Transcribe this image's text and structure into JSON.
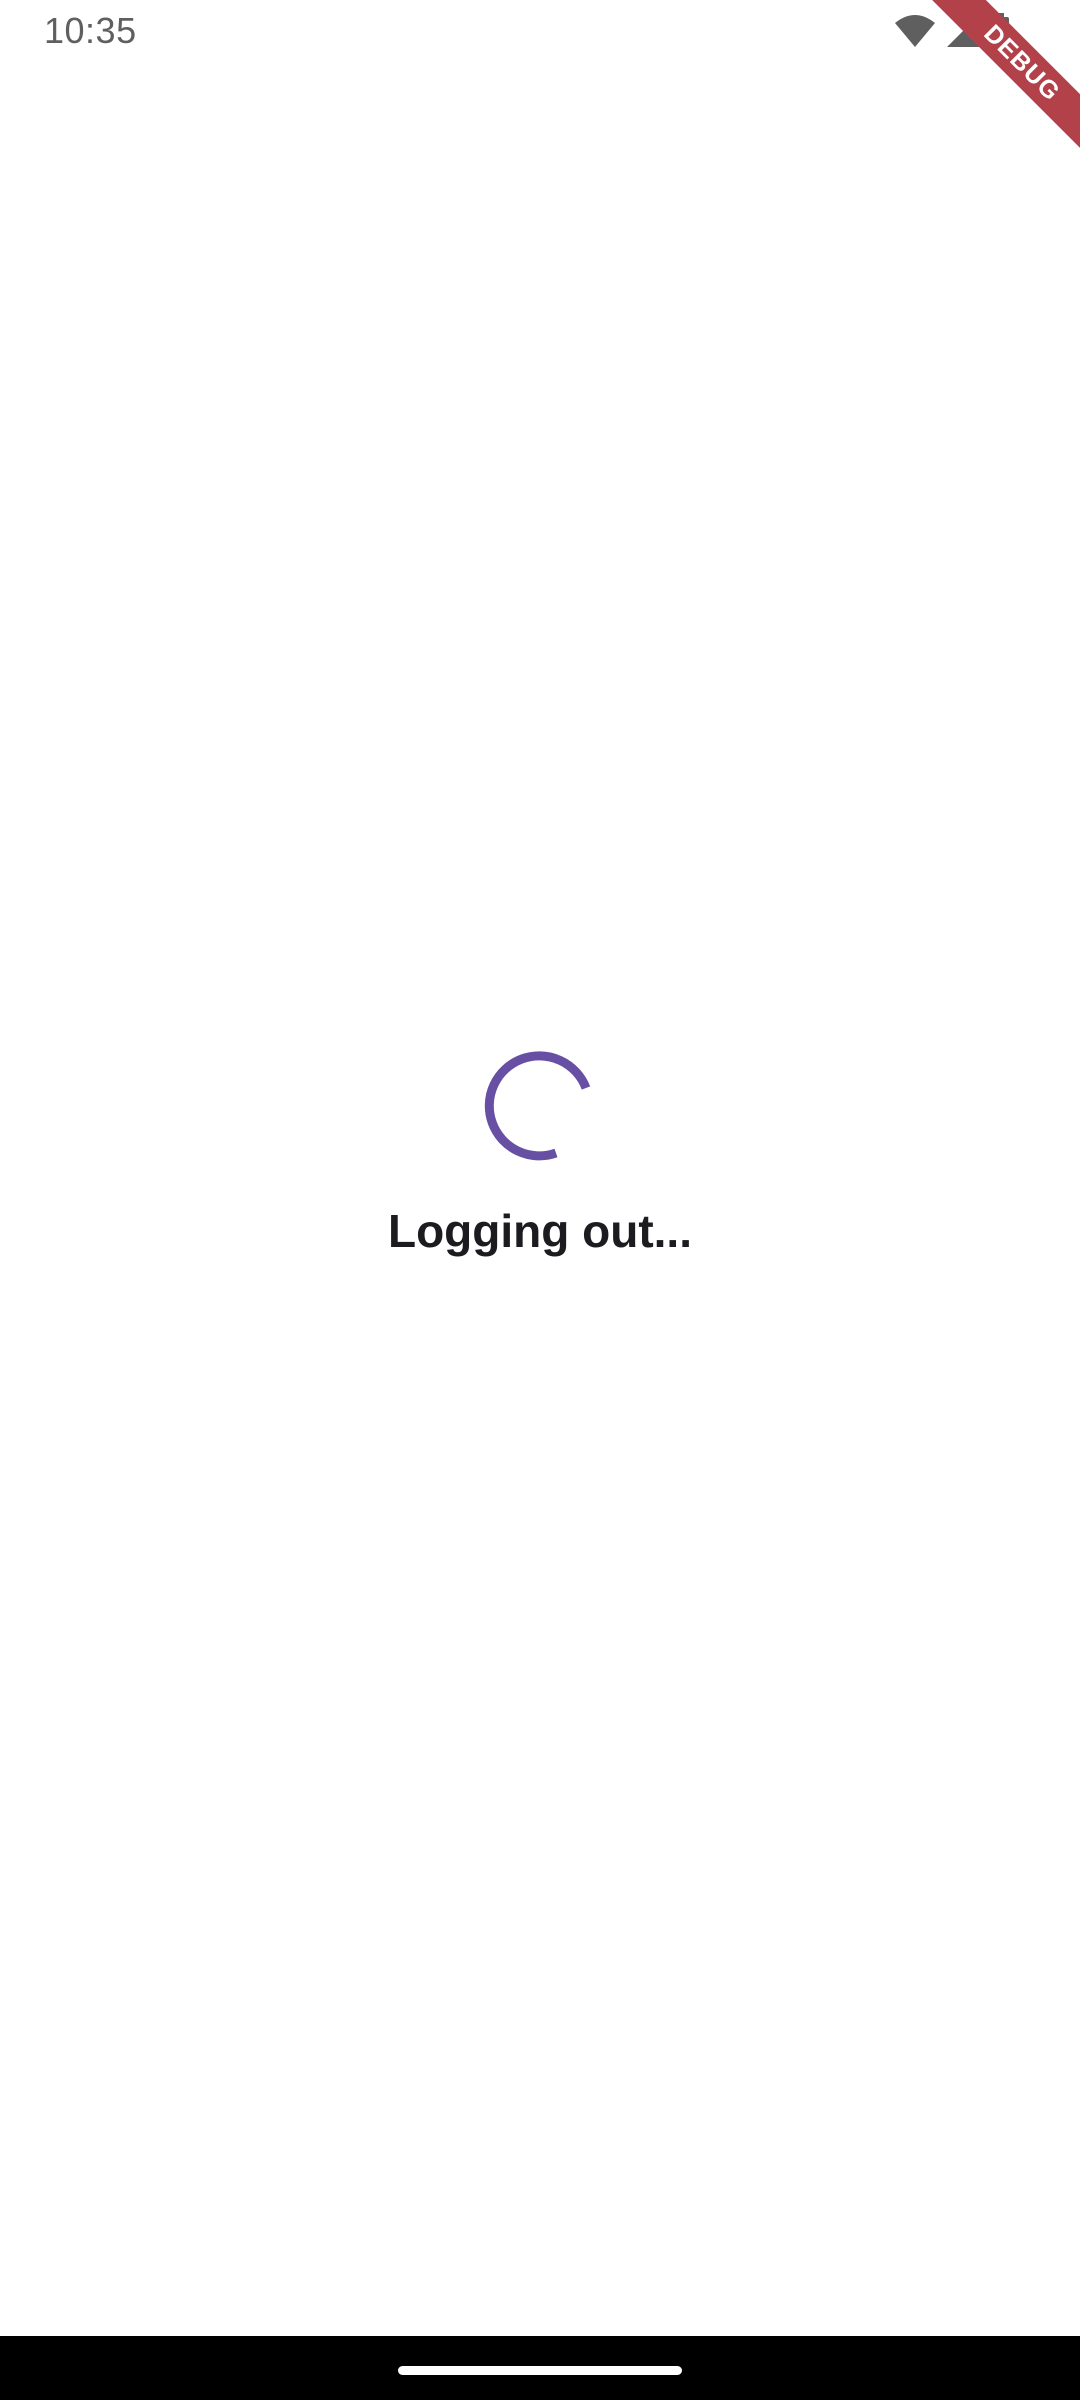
{
  "status_bar": {
    "time": "10:35",
    "icons": [
      "wifi-icon",
      "cellular-signal-icon",
      "battery-icon"
    ]
  },
  "debug_banner": {
    "label": "DEBUG",
    "color": "#b3414a"
  },
  "main": {
    "loading_text": "Logging out...",
    "spinner_color": "#6750a4",
    "spinner_icon": "progress-spinner-icon"
  },
  "nav_bar": {
    "handle": "home-gesture-handle"
  }
}
